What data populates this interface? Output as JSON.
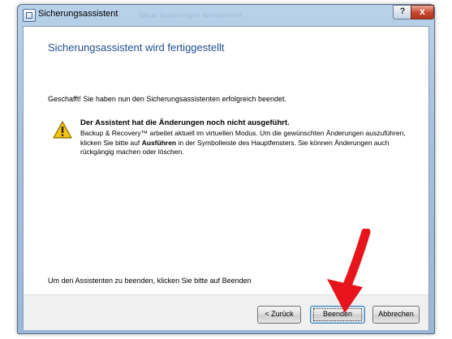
{
  "window": {
    "title": "Sicherungsassistent",
    "title_ghost": "Neue Sicherungen    Wiederherst...",
    "help_label": "?",
    "close_label": "x"
  },
  "content": {
    "heading": "Sicherungsassistent wird fertiggestellt",
    "intro": "Geschafft! Sie haben nun den Sicherungsassistenten erfolgreich beendet.",
    "warning_title": "Der Assistent hat die Änderungen noch nicht ausgeführt.",
    "warning_part1": "Backup & Recovery™ arbeitet aktuell im virtuellen Modus. Um die gewünschten Änderungen auszuführen, klicken Sie bitte auf ",
    "warning_bold": "Ausführen",
    "warning_part2": " in der Symbolleiste des Hauptfensters. Sie können Änderungen auch rückgängig machen oder löschen.",
    "finish_hint": "Um den Assistenten zu beenden, klicken Sie bitte auf Beenden"
  },
  "buttons": {
    "back": "< Zurück",
    "finish": "Beenden",
    "cancel": "Abbrechen"
  },
  "colors": {
    "heading": "#1e4f8f",
    "arrow": "#e8141b",
    "warning": "#f2c40f"
  }
}
